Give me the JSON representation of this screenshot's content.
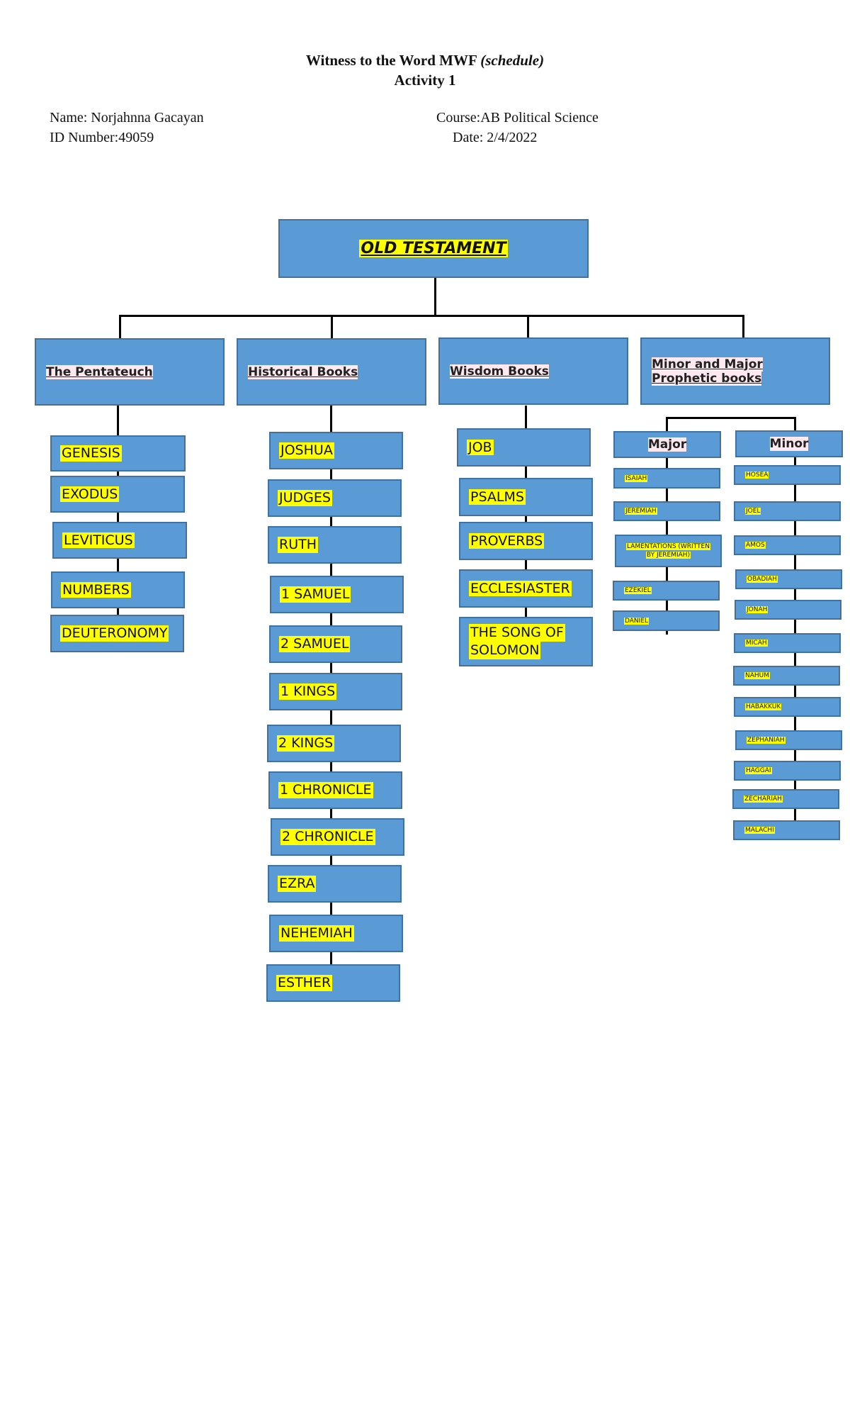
{
  "header": {
    "title_main": "Witness to the Word MWF ",
    "title_italic": "(schedule)",
    "subtitle": "Activity 1",
    "name": "Name: Norjahnna Gacayan",
    "id_number": "ID Number:49059",
    "course": "Course:AB Political Science",
    "date": "Date: 2/4/2022"
  },
  "chart": {
    "root": "OLD TESTAMENT",
    "categories": [
      {
        "label": "The Pentateuch",
        "books": [
          "GENESIS",
          "EXODUS",
          "LEVITICUS",
          "NUMBERS",
          "DEUTERONOMY"
        ]
      },
      {
        "label": "Historical Books",
        "books": [
          "JOSHUA",
          "JUDGES",
          "RUTH",
          "1 SAMUEL",
          "2 SAMUEL",
          "1 KINGS",
          "2 KINGS",
          "1 CHRONICLE",
          "2 CHRONICLE",
          "EZRA",
          "NEHEMIAH",
          "ESTHER"
        ]
      },
      {
        "label": "Wisdom Books",
        "books": [
          "JOB",
          "PSALMS",
          "PROVERBS",
          "ECCLESIASTER",
          "THE SONG OF SOLOMON"
        ]
      },
      {
        "label": "Minor and Major Prophetic books",
        "label_line1": "Minor and Major",
        "label_line2": "Prophetic books",
        "groups": [
          {
            "label": "Major",
            "books": [
              "ISAIAH",
              "JEREMIAH",
              "LAMENTATIONS (WRITTEN BY JEREMIAH)",
              "EZEKIEL",
              "DANIEL"
            ]
          },
          {
            "label": "Minor",
            "books": [
              "HOSEA",
              "JOEL",
              "AMOS",
              "OBADIAH",
              "JONAH",
              "MICAH",
              "NAHUM",
              "HABAKKUK",
              "ZEPHANIAH",
              "HAGGAI",
              "ZECHARIAH",
              "MALACHI"
            ]
          }
        ]
      }
    ],
    "lamentations_line1": "LAMENTATIONS (WRITTEN",
    "lamentations_line2": "BY JEREMIAH)",
    "song_line1": "THE SONG OF",
    "song_line2": "SOLOMON"
  },
  "colors": {
    "box_fill": "#5b9bd5",
    "box_border": "#41719c",
    "highlight": "#ffff00",
    "category_highlight": "#fde9ef"
  }
}
